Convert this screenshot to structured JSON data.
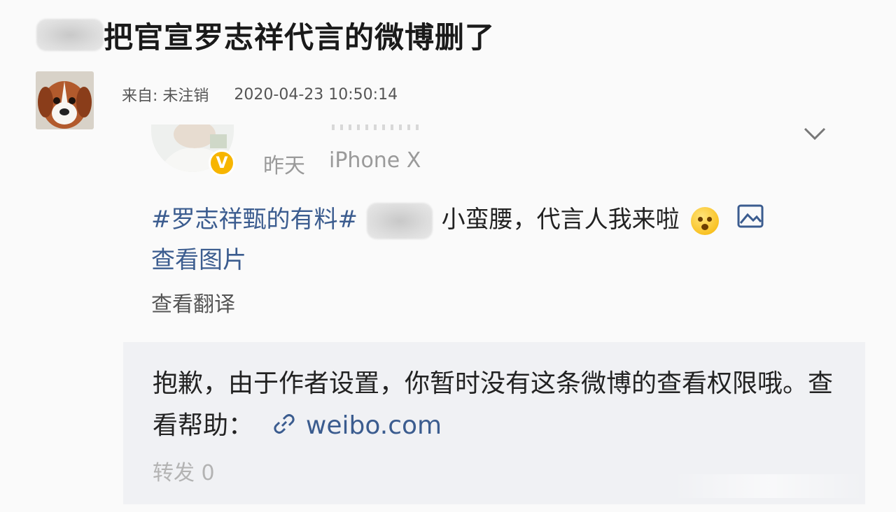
{
  "title": {
    "text": "把官宣罗志祥代言的微博删了"
  },
  "comment": {
    "source_label": "来自: 未注销",
    "timestamp": "2020-04-23 10:50:14"
  },
  "post": {
    "time": "昨天",
    "device": "iPhone X",
    "hashtag": "#罗志祥甄的有料#",
    "text_tail": "小蛮腰，代言人我来啦",
    "view_image": "查看图片",
    "view_translation": "查看翻译",
    "icons": {
      "verified": "verified-badge-icon",
      "dropdown": "chevron-down-icon",
      "image": "image-icon",
      "emoji": "flushed-face-emoji"
    }
  },
  "notice": {
    "text": "抱歉，由于作者设置，你暂时没有这条微博的查看权限哦。查看帮助：",
    "link_text": "weibo.com",
    "repost": "转发 0"
  },
  "colors": {
    "link": "#3b5c8f",
    "badge": "#f7b500",
    "notice_bg": "#f0f1f4"
  }
}
